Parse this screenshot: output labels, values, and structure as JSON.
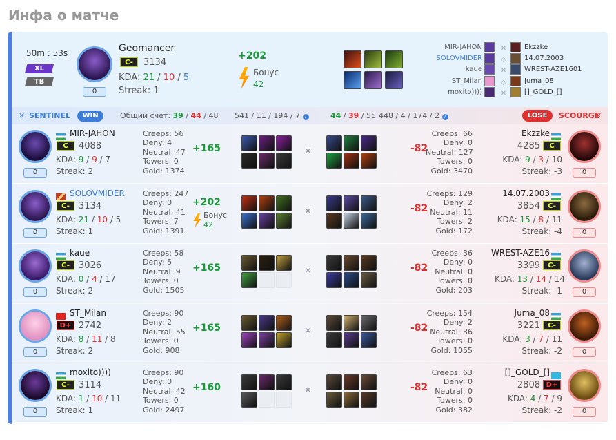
{
  "page_title": "Инфа о матче",
  "match": {
    "duration": "50m : 53s",
    "mode_tag": "XL",
    "map_tag": "TB",
    "mvp": {
      "name": "Geomancer",
      "rank": "C-",
      "mmr": "3134",
      "kda_label": "KDA:",
      "kills": "21",
      "deaths": "10",
      "assists": "5",
      "streak": "Streak: 1",
      "zero": "0"
    },
    "mvp_gain": "+202",
    "mvp_bonus_label": "Бонус",
    "mvp_bonus_value": "42",
    "lineup_left": [
      "MIR-JAHON",
      "SOLOVMIDER",
      "kaue",
      "ST_Milan",
      "moxito))))"
    ],
    "lineup_right": [
      "Ekzzke",
      "14.07.2003",
      "WREST-AZE1601",
      "Juma_08",
      "[]_GOLD_[]"
    ]
  },
  "band": {
    "sentinel_label": "SENTINEL",
    "win_label": "WIN",
    "score_label": "Общий счет:",
    "left_kills": "39",
    "left_deaths": "44",
    "left_assists": "48",
    "left_totals": "541 / 11 / 194 / 7",
    "right_kills": "44",
    "right_deaths": "39",
    "right_assists": "55",
    "right_totals": "448 / 4 / 174 / 2",
    "lose_label": "LOSE",
    "scourge_label": "SCOURGE"
  },
  "rows": [
    {
      "l": {
        "name": "MIR-JAHON",
        "rank": "C",
        "mmr": "4088",
        "k": "9",
        "d": "9",
        "a": "7",
        "streak": "Streak: 2",
        "zero": "0"
      },
      "ls": [
        "Creeps: 56",
        "Deny: 4",
        "Neutral: 47",
        "Towers: 0",
        "Gold: 1374"
      ],
      "lgain": "+165",
      "rgain": "-82",
      "rs": [
        "Creeps: 66",
        "Deny: 0",
        "Neutral: 127",
        "Towers: 0",
        "Gold: 3470"
      ],
      "r": {
        "name": "Ekzzke",
        "rank": "C",
        "mmr": "4285",
        "k": "9",
        "d": "3",
        "a": "10",
        "streak": "Streak: -3",
        "zero": "0"
      }
    },
    {
      "l": {
        "name": "SOLOVMIDER",
        "rank": "C-",
        "mmr": "3134",
        "k": "21",
        "d": "10",
        "a": "5",
        "streak": "Streak: 1",
        "zero": "0"
      },
      "ls": [
        "Creeps: 247",
        "Deny: 0",
        "Neutral: 41",
        "Towers: 7",
        "Gold: 1391"
      ],
      "lgain": "+202",
      "lbonus_label": "Бонус",
      "lbonus": "42",
      "rgain": "-82",
      "rs": [
        "Creeps: 129",
        "Deny: 2",
        "Neutral: 11",
        "Towers: 2",
        "Gold: 172"
      ],
      "r": {
        "name": "14.07.2003",
        "rank": "C-",
        "mmr": "3854",
        "k": "15",
        "d": "8",
        "a": "11",
        "streak": "Streak: -4",
        "zero": "0"
      }
    },
    {
      "l": {
        "name": "kaue",
        "rank": "C-",
        "mmr": "3026",
        "k": "0",
        "d": "4",
        "a": "17",
        "streak": "Streak: 2",
        "zero": "0"
      },
      "ls": [
        "Creeps: 58",
        "Deny: 5",
        "Neutral: 9",
        "Towers: 0",
        "Gold: 1505"
      ],
      "lgain": "+165",
      "rgain": "-82",
      "rs": [
        "Creeps: 36",
        "Deny: 0",
        "Neutral: 0",
        "Towers: 0",
        "Gold: 203"
      ],
      "r": {
        "name": "WREST-AZE16",
        "rank": "C-",
        "mmr": "3399",
        "k": "13",
        "d": "14",
        "a": "14",
        "streak": "Streak: -1",
        "zero": "0"
      }
    },
    {
      "l": {
        "name": "ST_Milan",
        "rank": "D+",
        "mmr": "2742",
        "k": "8",
        "d": "11",
        "a": "8",
        "streak": "Streak: 2",
        "zero": "0"
      },
      "ls": [
        "Creeps: 90",
        "Deny: 2",
        "Neutral: 55",
        "Towers: 0",
        "Gold: 908"
      ],
      "lgain": "+165",
      "rgain": "-82",
      "rs": [
        "Creeps: 154",
        "Deny: 2",
        "Neutral: 36",
        "Towers: 0",
        "Gold: 1055"
      ],
      "r": {
        "name": "Juma_08",
        "rank": "C-",
        "mmr": "3221",
        "k": "3",
        "d": "7",
        "a": "11",
        "streak": "Streak: -2",
        "zero": "0"
      }
    },
    {
      "l": {
        "name": "moxito))))",
        "rank": "C-",
        "mmr": "3114",
        "k": "1",
        "d": "10",
        "a": "11",
        "streak": "Streak: 1",
        "zero": "0"
      },
      "ls": [
        "Creeps: 90",
        "Deny: 0",
        "Neutral: 42",
        "Towers: 0",
        "Gold: 2497"
      ],
      "lgain": "+160",
      "rgain": "-82",
      "rs": [
        "Creeps: 63",
        "Deny: 0",
        "Neutral: 0",
        "Towers: 0",
        "Gold: 382"
      ],
      "r": {
        "name": "[]_GOLD_[]",
        "rank": "D+",
        "mmr": "2808",
        "k": "4",
        "d": "7",
        "a": "9",
        "streak": "Streak: -2",
        "zero": "0"
      }
    }
  ],
  "colors": {
    "accent": "#4a7fe6",
    "win": "#3d7fd8",
    "lose": "#e03131",
    "gain": "#1c9a3a",
    "rank_text": "#e5ff26"
  }
}
